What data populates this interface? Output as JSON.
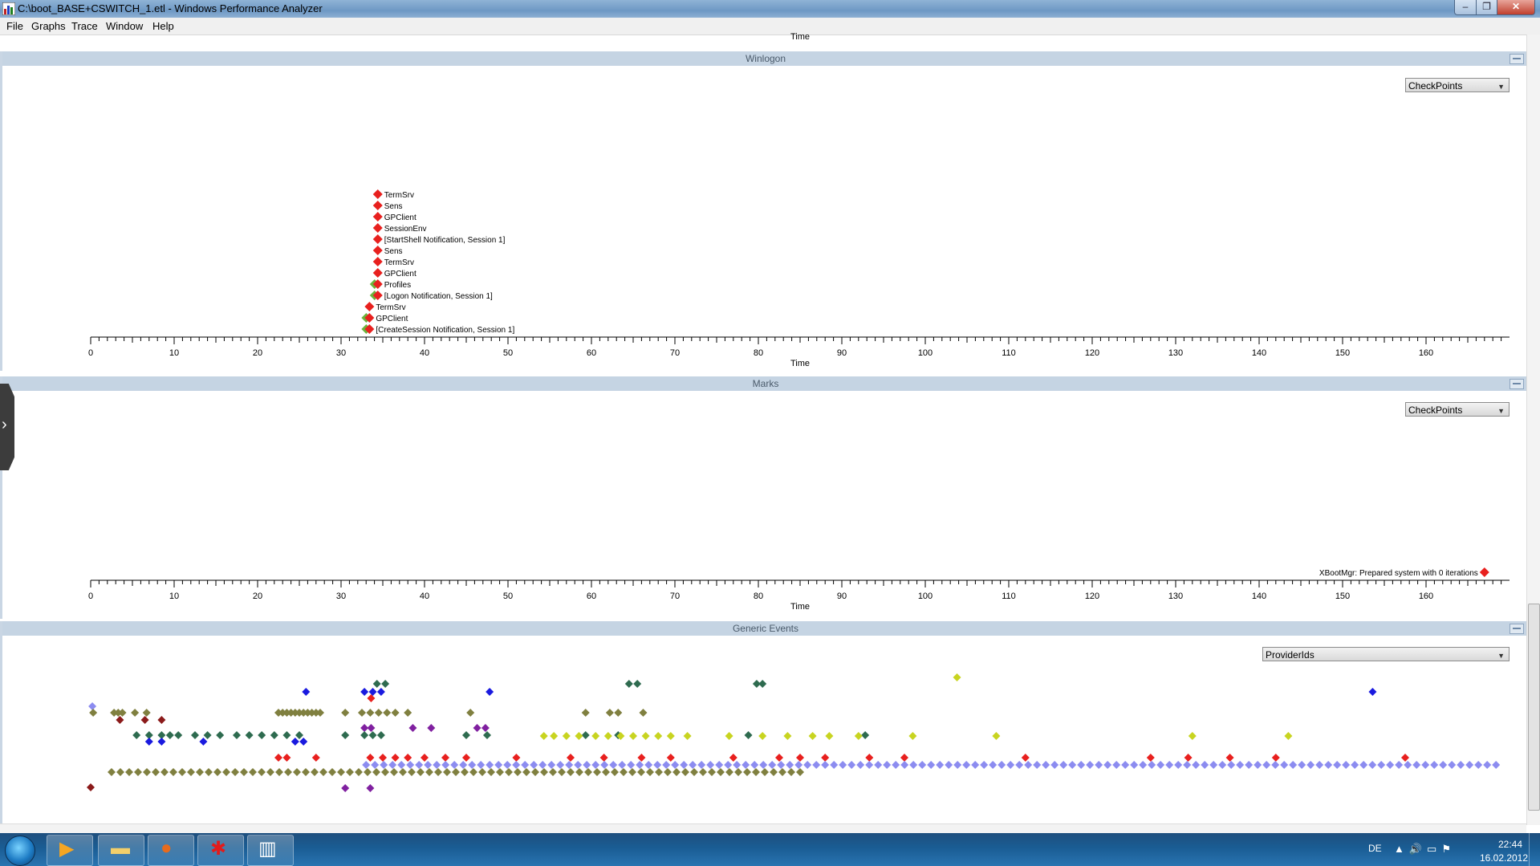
{
  "window": {
    "title": "C:\\boot_BASE+CSWITCH_1.etl - Windows Performance Analyzer",
    "controls": {
      "minimize": "–",
      "maximize": "❐",
      "close": "✕"
    }
  },
  "menu": [
    "File",
    "Graphs",
    "Trace",
    "Window",
    "Help"
  ],
  "top_axis_label": "Time",
  "panels": {
    "winlogon": {
      "title": "Winlogon",
      "dropdown": "CheckPoints",
      "xlabel": "Time"
    },
    "marks": {
      "title": "Marks",
      "dropdown": "CheckPoints",
      "xlabel": "Time"
    },
    "generic": {
      "title": "Generic Events",
      "dropdown": "ProviderIds"
    }
  },
  "colors": {
    "checkpoint_red": "#e8201e",
    "checkpoint_green": "#6cb33c",
    "lavender": "#8c8cf0",
    "olive": "#808040",
    "dark_green": "#2e6b4f",
    "blue": "#1a1adf",
    "yellow": "#c8d420",
    "purple": "#8020a0",
    "maroon": "#8b1a1a"
  },
  "chart_data": [
    {
      "type": "scatter",
      "title": "Winlogon",
      "xlabel": "Time",
      "xlim": [
        0,
        170
      ],
      "x_ticks": [
        0,
        10,
        20,
        30,
        40,
        50,
        60,
        70,
        80,
        90,
        100,
        110,
        120,
        130,
        140,
        150,
        160
      ],
      "points": [
        {
          "x": 34.4,
          "label": "TermSrv",
          "color": "red"
        },
        {
          "x": 34.4,
          "label": "Sens",
          "color": "red"
        },
        {
          "x": 34.4,
          "label": "GPClient",
          "color": "red"
        },
        {
          "x": 34.4,
          "label": "SessionEnv",
          "color": "red"
        },
        {
          "x": 34.4,
          "label": "[StartShell Notification, Session 1]",
          "color": "red"
        },
        {
          "x": 34.4,
          "label": "Sens",
          "color": "red"
        },
        {
          "x": 34.4,
          "label": "TermSrv",
          "color": "red"
        },
        {
          "x": 34.4,
          "label": "GPClient",
          "color": "red"
        },
        {
          "x": 34.4,
          "label": "Profiles",
          "color": "green-red"
        },
        {
          "x": 34.4,
          "label": "[Logon Notification, Session 1]",
          "color": "green-red"
        },
        {
          "x": 33.4,
          "label": "TermSrv",
          "color": "red"
        },
        {
          "x": 33.4,
          "label": "GPClient",
          "color": "green-red"
        },
        {
          "x": 33.4,
          "label": "[CreateSession Notification, Session 1]",
          "color": "green-red"
        }
      ]
    },
    {
      "type": "scatter",
      "title": "Marks",
      "xlabel": "Time",
      "xlim": [
        0,
        170
      ],
      "x_ticks": [
        0,
        10,
        20,
        30,
        40,
        50,
        60,
        70,
        80,
        90,
        100,
        110,
        120,
        130,
        140,
        150,
        160
      ],
      "points": [
        {
          "x": 167,
          "label": "XBootMgr: Prepared system with 0 iterations",
          "color": "red"
        }
      ]
    },
    {
      "type": "scatter",
      "title": "Generic Events",
      "xlim": [
        0,
        170
      ],
      "rows": [
        {
          "name": "lavender-1",
          "color": "lavender",
          "x": [
            0.2
          ]
        },
        {
          "name": "olive-1",
          "color": "olive",
          "x": [
            0.3,
            2.8,
            3.3,
            3.8,
            5.3,
            6.7,
            22.5,
            23,
            23.5,
            24,
            24.5,
            25,
            25.5,
            26,
            26.5,
            27,
            27.5,
            30.5,
            32.5,
            33.5,
            34.5,
            35.5,
            36.5,
            38,
            45.5,
            59.3,
            62.2,
            63.2,
            66.2
          ]
        },
        {
          "name": "maroon-1",
          "color": "maroon",
          "x": [
            3.5,
            6.5,
            8.5
          ]
        },
        {
          "name": "dark-green-top",
          "color": "dark_green",
          "x": [
            34.3,
            35.3,
            64.5,
            65.5,
            79.8,
            80.5
          ]
        },
        {
          "name": "yellow-top",
          "color": "yellow",
          "x": [
            103.8
          ]
        },
        {
          "name": "blue-top",
          "color": "blue",
          "x": [
            25.8,
            32.8,
            33.8,
            34.8,
            47.8,
            153.6
          ]
        },
        {
          "name": "red-top",
          "color": "checkpoint_red",
          "x": [
            33.6
          ]
        },
        {
          "name": "purple-1",
          "color": "purple",
          "x": [
            32.8,
            33.6,
            38.6,
            40.8,
            46.3,
            47.3
          ]
        },
        {
          "name": "dark-green-1",
          "color": "dark_green",
          "x": [
            5.5,
            7,
            8.5,
            9.5,
            10.5,
            12.5,
            14,
            15.5,
            17.5,
            19,
            20.5,
            22,
            23.5,
            25,
            30.5,
            32.8,
            33.8,
            34.8,
            45,
            47.5,
            59.3,
            63.2,
            78.8,
            92.8
          ]
        },
        {
          "name": "yellow-1",
          "color": "yellow",
          "x": [
            54.3,
            55.5,
            57,
            58.5,
            60.5,
            62,
            63.5,
            65,
            66.5,
            68,
            69.5,
            71.5,
            76.5,
            80.5,
            83.5,
            86.5,
            88.5,
            92,
            98.5,
            108.5,
            132,
            143.5
          ]
        },
        {
          "name": "blue-1",
          "color": "blue",
          "x": [
            7,
            8.5,
            13.5,
            24.5,
            25.5
          ]
        },
        {
          "name": "red-1",
          "color": "checkpoint_red",
          "x": [
            22.5,
            23.5,
            27,
            33.5,
            35,
            36.5,
            38,
            40,
            42.5,
            45,
            51,
            57.5,
            61.5,
            66,
            69.5,
            77,
            82.5,
            85,
            88,
            93.3,
            97.5,
            112,
            127,
            131.5,
            136.5,
            142,
            157.5
          ]
        },
        {
          "name": "lavender-2",
          "color": "lavender",
          "x_range": [
            33,
            169
          ]
        },
        {
          "name": "olive-2",
          "color": "olive",
          "x_range": [
            2.5,
            86
          ]
        },
        {
          "name": "maroon-2",
          "color": "maroon",
          "x": [
            0
          ]
        },
        {
          "name": "purple-2",
          "color": "purple",
          "x": [
            30.5,
            33.5
          ]
        }
      ]
    }
  ],
  "taskbar": {
    "buttons": [
      "media-player",
      "explorer",
      "firefox",
      "xperf-tool",
      "performance-analyzer"
    ],
    "language": "DE",
    "time": "22:44",
    "date": "16.02.2012"
  }
}
